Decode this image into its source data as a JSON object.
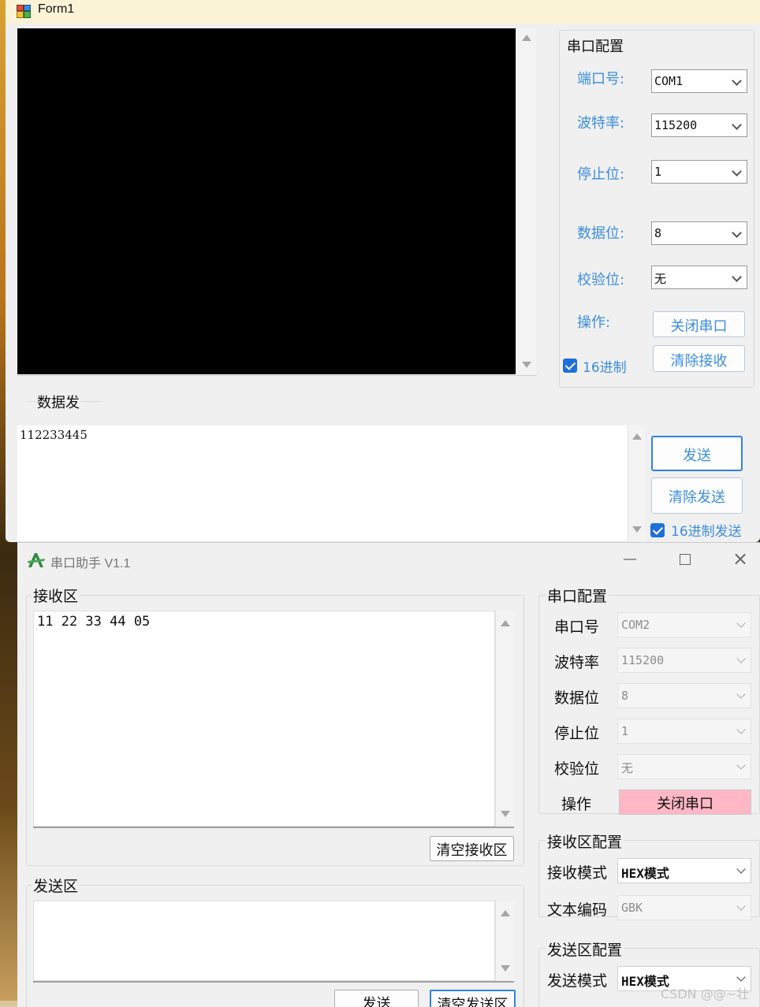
{
  "form1": {
    "title": "Form1",
    "config_group": {
      "title": "串口配置",
      "port_label": "端口号:",
      "port_value": "COM1",
      "baud_label": "波特率:",
      "baud_value": "115200",
      "stop_label": "停止位:",
      "stop_value": "1",
      "data_label": "数据位:",
      "data_value": "8",
      "parity_label": "校验位:",
      "parity_value": "无",
      "op_label": "操作:",
      "close_port_label": "关闭串口",
      "clear_recv_label": "清除接收",
      "hex_label": "16进制",
      "hex_checked": true
    },
    "send_group": {
      "title": "数据发",
      "send_text": "112233445",
      "send_label": "发送",
      "clear_send_label": "清除发送",
      "hex_send_label": "16进制发送",
      "hex_send_checked": true
    }
  },
  "assistant": {
    "title": "串口助手 V1.1",
    "recv_group": {
      "title": "接收区",
      "text": "11 22 33 44 05",
      "clear_label": "清空接收区"
    },
    "send_group": {
      "title": "发送区",
      "text": "",
      "send_label": "发送",
      "clear_label": "清空发送区"
    },
    "config_group": {
      "title": "串口配置",
      "port_label": "串口号",
      "port_value": "COM2",
      "baud_label": "波特率",
      "baud_value": "115200",
      "data_label": "数据位",
      "data_value": "8",
      "stop_label": "停止位",
      "stop_value": "1",
      "parity_label": "校验位",
      "parity_value": "无",
      "op_label": "操作",
      "close_port_label": "关闭串口"
    },
    "recv_config": {
      "title": "接收区配置",
      "mode_label": "接收模式",
      "mode_value": "HEX模式",
      "encoding_label": "文本编码",
      "encoding_value": "GBK"
    },
    "send_config": {
      "title": "发送区配置",
      "mode_label": "发送模式",
      "mode_value": "HEX模式"
    }
  },
  "watermark": "CSDN @@~壮"
}
